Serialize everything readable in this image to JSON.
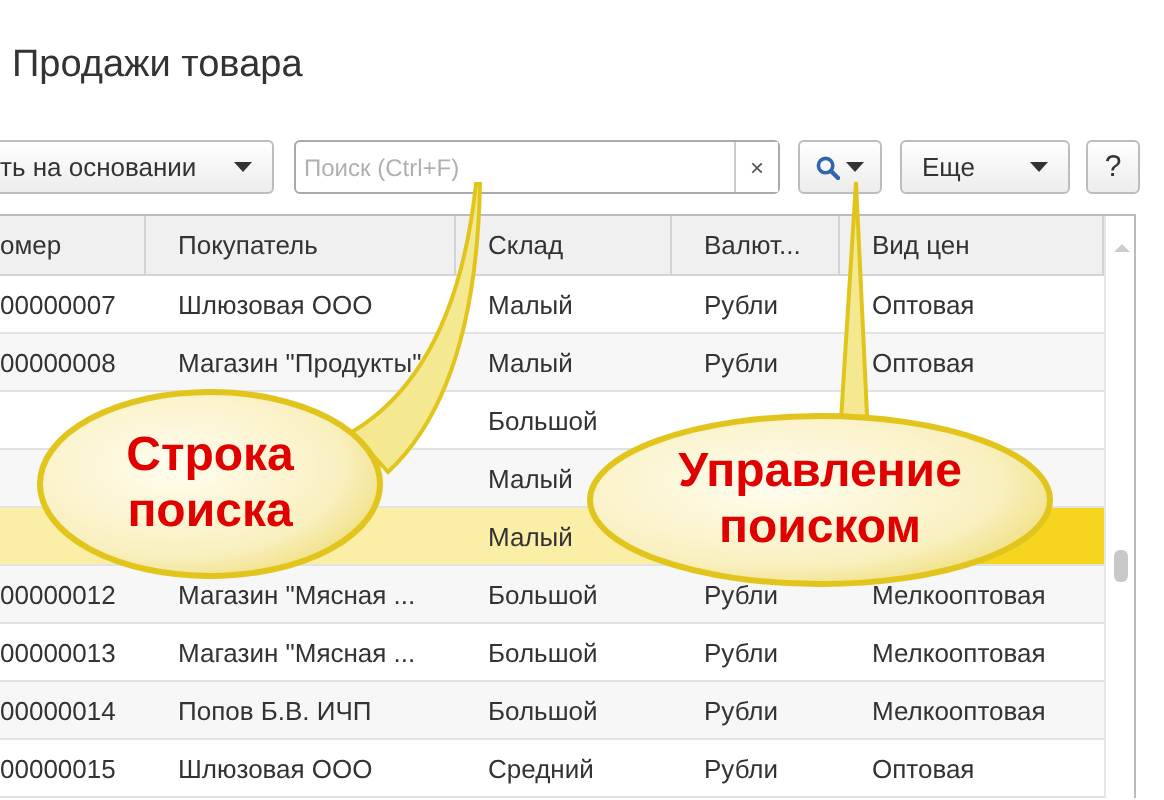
{
  "window": {
    "title": "Продажи товара"
  },
  "toolbar": {
    "based_on_button": "ть на основании",
    "search": {
      "placeholder": "Поиск (Ctrl+F)",
      "clear": "×"
    },
    "more_button": "Еще",
    "help_button": "?"
  },
  "table": {
    "columns": [
      "омер",
      "Покупатель",
      "Склад",
      "Валют...",
      "Вид цен"
    ],
    "rows": [
      {
        "selected": false,
        "cells": {
          "number": "00000007",
          "buyer": "Шлюзовая ООО",
          "warehouse": "Малый",
          "currency": "Рубли",
          "price_type": "Оптовая"
        }
      },
      {
        "selected": false,
        "cells": {
          "number": "00000008",
          "buyer": "Магазин \"Продукты\"",
          "warehouse": "Малый",
          "currency": "Рубли",
          "price_type": "Оптовая"
        }
      },
      {
        "selected": false,
        "cells": {
          "warehouse": "Большой"
        }
      },
      {
        "selected": false,
        "cells": {
          "warehouse": "Малый"
        }
      },
      {
        "selected": true,
        "cells": {
          "warehouse": "Малый"
        }
      },
      {
        "selected": false,
        "cells": {
          "number": "00000012",
          "buyer": "Магазин \"Мясная ...",
          "warehouse": "Большой",
          "currency": "Рубли",
          "price_type": "Мелкооптовая"
        }
      },
      {
        "selected": false,
        "cells": {
          "number": "00000013",
          "buyer": "Магазин \"Мясная ...",
          "warehouse": "Большой",
          "currency": "Рубли",
          "price_type": "Мелкооптовая"
        }
      },
      {
        "selected": false,
        "cells": {
          "number": "00000014",
          "buyer": "Попов Б.В. ИЧП",
          "warehouse": "Большой",
          "currency": "Рубли",
          "price_type": "Мелкооптовая"
        }
      },
      {
        "selected": false,
        "cells": {
          "number": "00000015",
          "buyer": "Шлюзовая ООО",
          "warehouse": "Средний",
          "currency": "Рубли",
          "price_type": "Оптовая"
        }
      }
    ]
  },
  "callouts": [
    {
      "text": "Строка поиска"
    },
    {
      "text": "Управление поиском"
    }
  ]
}
